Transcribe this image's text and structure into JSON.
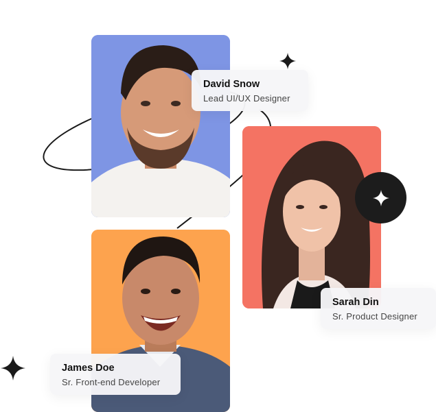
{
  "people": [
    {
      "name": "David Snow",
      "role": "Lead UI/UX Designer",
      "bg": "#7e95e4"
    },
    {
      "name": "Sarah Din",
      "role": "Sr. Product Designer",
      "bg": "#f47363"
    },
    {
      "name": "James Doe",
      "role": "Sr. Front-end Developer",
      "bg": "#fda34e"
    }
  ],
  "icons": [
    "sparkle-icon",
    "sparkle-badge-icon"
  ],
  "colors": {
    "dark": "#1c1c1c",
    "text": "#111111",
    "muted": "#444444"
  }
}
